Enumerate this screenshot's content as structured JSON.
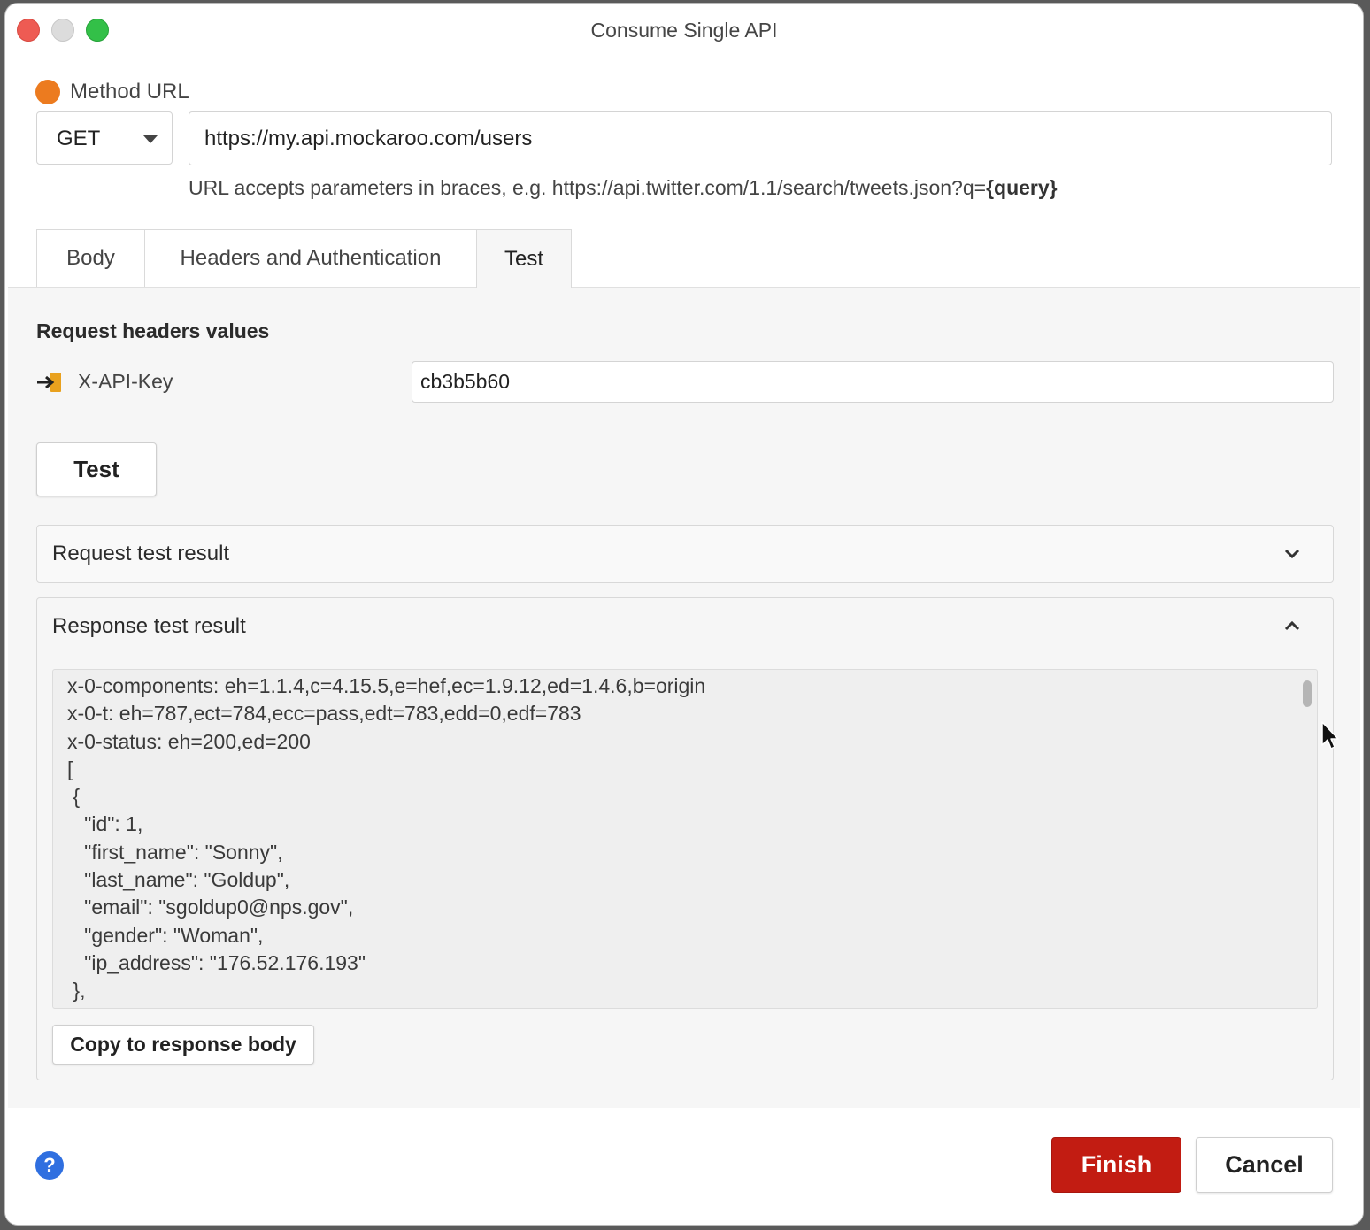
{
  "window": {
    "title": "Consume Single API"
  },
  "method_url": {
    "label": "Method URL",
    "method": "GET",
    "url": "https://my.api.mockaroo.com/users",
    "hint_prefix": "URL accepts parameters in braces, e.g. https://api.twitter.com/1.1/search/tweets.json?q=",
    "hint_param": "{query}"
  },
  "tabs": [
    {
      "label": "Body",
      "active": false
    },
    {
      "label": "Headers and Authentication",
      "active": false
    },
    {
      "label": "Test",
      "active": true
    }
  ],
  "test_panel": {
    "section_title": "Request headers values",
    "header_name": "X-API-Key",
    "header_value": "cb3b5b60",
    "test_button": "Test",
    "request_result_title": "Request test result",
    "response_result_title": "Response test result",
    "response_lines": [
      "x-0-components: eh=1.1.4,c=4.15.5,e=hef,ec=1.9.12,ed=1.4.6,b=origin",
      "x-0-t: eh=787,ect=784,ecc=pass,edt=783,edd=0,edf=783",
      "x-0-status: eh=200,ed=200",
      "[",
      " {",
      "   \"id\": 1,",
      "   \"first_name\": \"Sonny\",",
      "   \"last_name\": \"Goldup\",",
      "   \"email\": \"sgoldup0@nps.gov\",",
      "   \"gender\": \"Woman\",",
      "   \"ip_address\": \"176.52.176.193\"",
      " },"
    ],
    "copy_button": "Copy to response body"
  },
  "footer": {
    "help_icon": "question-mark-icon",
    "help_glyph": "?",
    "finish": "Finish",
    "cancel": "Cancel"
  },
  "colors": {
    "accent_orange": "#ec7b1f",
    "finish_red": "#c21c12",
    "help_blue": "#2f6fe0"
  }
}
